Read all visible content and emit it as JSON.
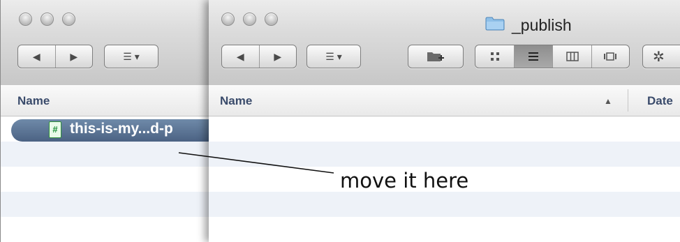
{
  "back_window": {
    "column_header": "Name",
    "selected_file": "this-is-my...d-p",
    "file_icon_glyph": "#"
  },
  "front_window": {
    "title": "_publish",
    "column_headers": {
      "name": "Name",
      "date": "Date"
    },
    "sort_indicator": "▲"
  },
  "toolbar": {
    "back_glyph": "◀",
    "forward_glyph": "▶",
    "arrange_glyph": "☰ ▾",
    "new_folder_glyph": "+",
    "gear_glyph": "✲"
  },
  "annotation": {
    "text": "move it here"
  },
  "colors": {
    "selection": "#5a7394",
    "header_text": "#3a4b6b",
    "row_alt": "#eef2f8"
  }
}
